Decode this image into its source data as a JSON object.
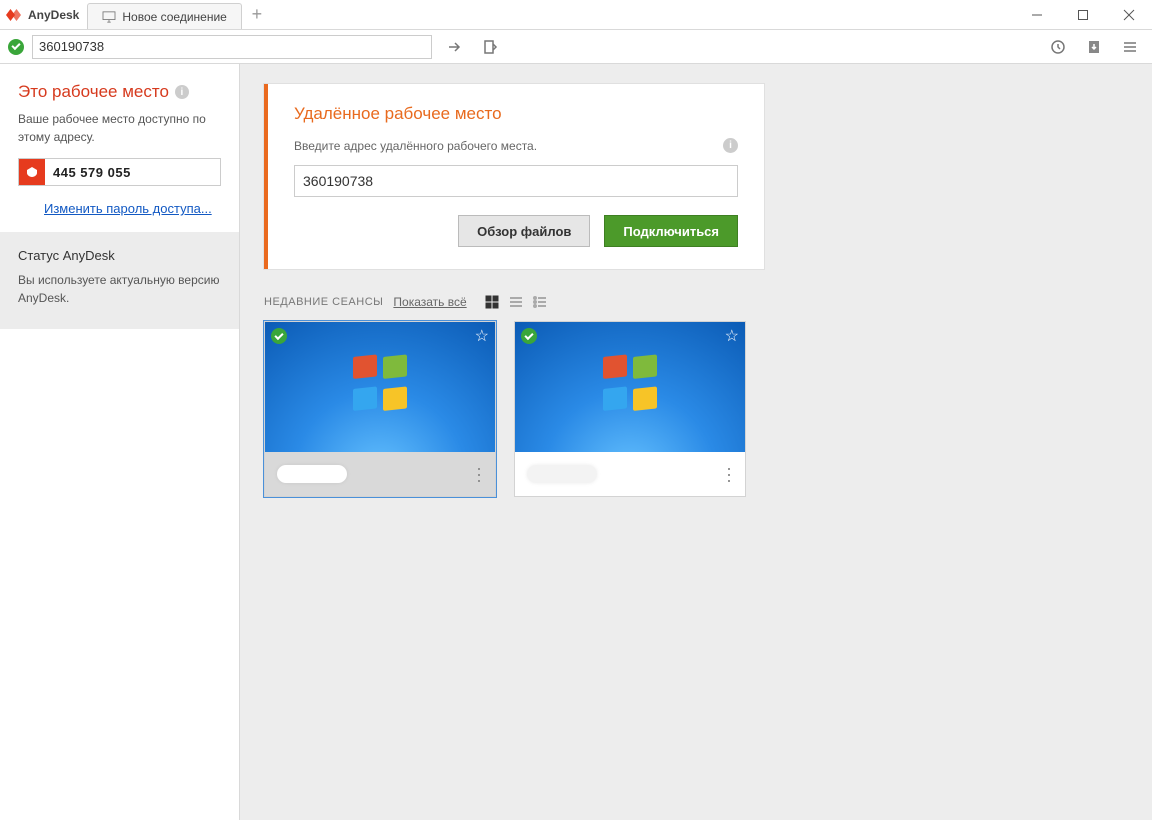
{
  "titlebar": {
    "brand": "AnyDesk",
    "tab_label": "Новое соединение"
  },
  "toolbar": {
    "address": "360190738"
  },
  "sidebar": {
    "workstation": {
      "heading": "Это рабочее место",
      "desc": "Ваше рабочее место доступно по этому адресу.",
      "address": "445 579 055",
      "change_pw": "Изменить пароль доступа..."
    },
    "status": {
      "heading": "Статус AnyDesk",
      "desc": "Вы используете актуальную версию AnyDesk."
    }
  },
  "card": {
    "heading": "Удалённое рабочее место",
    "hint": "Введите адрес удалённого рабочего места.",
    "remote_address": "360190738",
    "btn_browse": "Обзор файлов",
    "btn_connect": "Подключиться"
  },
  "recent": {
    "label": "НЕДАВНИЕ СЕАНСЫ",
    "show_all": "Показать всё"
  }
}
